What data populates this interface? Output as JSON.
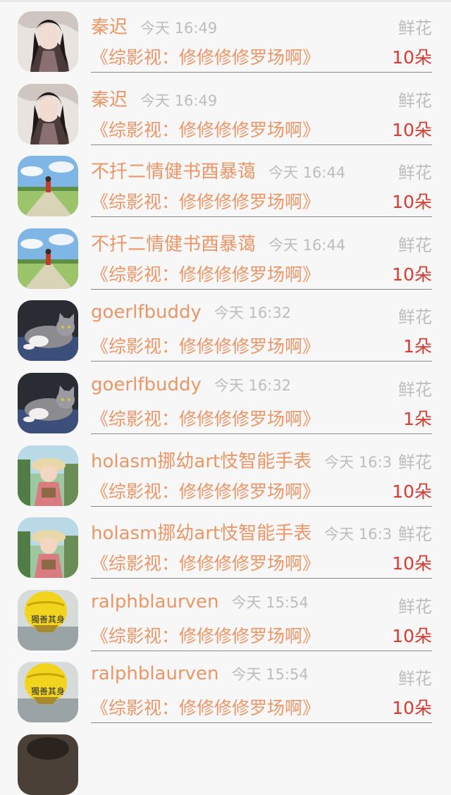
{
  "entries": [
    {
      "name": "秦迟",
      "time": "今天 16:49",
      "gift_label": "鲜花",
      "title": "《综影视：修修修修罗场啊》",
      "count": "10朵",
      "avatar": "avatar-warrior"
    },
    {
      "name": "秦迟",
      "time": "今天 16:49",
      "gift_label": "鲜花",
      "title": "《综影视：修修修修罗场啊》",
      "count": "10朵",
      "avatar": "avatar-warrior"
    },
    {
      "name": "不扦二情健书酉暴蔼",
      "time": "今天 16:44",
      "gift_label": "鲜花",
      "title": "《综影视：修修修修罗场啊》",
      "count": "10朵",
      "avatar": "avatar-landscape"
    },
    {
      "name": "不扦二情健书酉暴蔼",
      "time": "今天 16:44",
      "gift_label": "鲜花",
      "title": "《综影视：修修修修罗场啊》",
      "count": "10朵",
      "avatar": "avatar-landscape"
    },
    {
      "name": "goerlfbuddy",
      "time": "今天 16:32",
      "gift_label": "鲜花",
      "title": "《综影视：修修修修罗场啊》",
      "count": "1朵",
      "avatar": "avatar-cat"
    },
    {
      "name": "goerlfbuddy",
      "time": "今天 16:32",
      "gift_label": "鲜花",
      "title": "《综影视：修修修修罗场啊》",
      "count": "1朵",
      "avatar": "avatar-cat"
    },
    {
      "name": "holasm挪幼art忮智能手表",
      "time": "今天 16:3",
      "gift_label": "鲜花",
      "title": "《综影视：修修修修罗场啊》",
      "count": "10朵",
      "avatar": "avatar-girl"
    },
    {
      "name": "holasm挪幼art忮智能手表",
      "time": "今天 16:3",
      "gift_label": "鲜花",
      "title": "《综影视：修修修修罗场啊》",
      "count": "10朵",
      "avatar": "avatar-girl"
    },
    {
      "name": "ralphblaurven",
      "time": "今天 15:54",
      "gift_label": "鲜花",
      "title": "《综影视：修修修修罗场啊》",
      "count": "10朵",
      "avatar": "avatar-balloon"
    },
    {
      "name": "ralphblaurven",
      "time": "今天 15:54",
      "gift_label": "鲜花",
      "title": "《综影视：修修修修罗场啊》",
      "count": "10朵",
      "avatar": "avatar-balloon"
    }
  ],
  "balloon_text": "獨善其身",
  "colors": {
    "accent": "#eb9667",
    "count": "#d83b2f",
    "muted": "#bdbdbd",
    "background": "#f8f7f8"
  }
}
